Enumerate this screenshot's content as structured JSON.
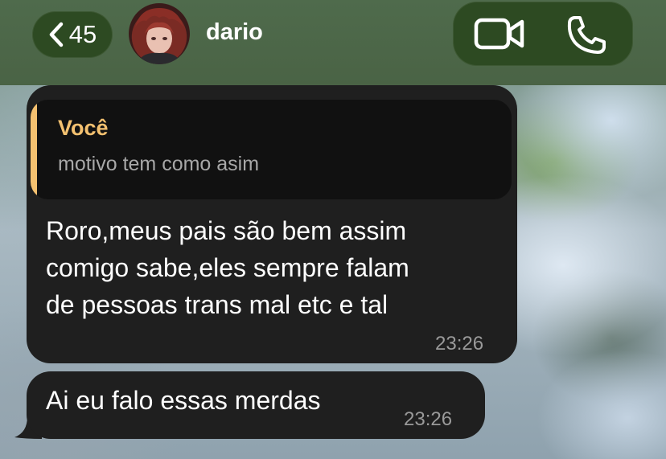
{
  "header": {
    "back_count": "45",
    "contact_name": "dario",
    "icons": [
      "chevron-left-icon",
      "video-camera-icon",
      "phone-icon"
    ]
  },
  "messages": [
    {
      "reply": {
        "sender": "Você",
        "text": "motivo tem como asim"
      },
      "text": "Roro,meus pais são bem assim\ncomigo sabe,eles sempre falam\nde pessoas trans mal etc e tal",
      "time": "23:26"
    },
    {
      "text": "Ai eu falo essas merdas",
      "time": "23:26"
    }
  ],
  "colors": {
    "header_bg": "#4a6345",
    "pill_bg": "#2d4a22",
    "bubble_bg": "#1f1f1f",
    "quote_accent": "#f4c170",
    "timestamp": "#9a9a9a"
  }
}
